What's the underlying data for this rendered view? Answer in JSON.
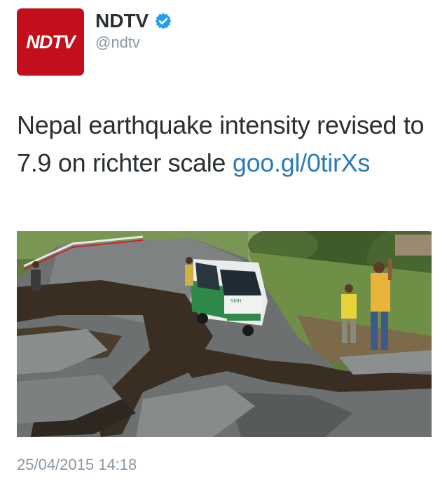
{
  "account": {
    "avatar_text": "NDTV",
    "display_name": "NDTV",
    "handle": "@ndtv",
    "verified": true,
    "brand_color": "#c30e1b"
  },
  "tweet": {
    "text": "Nepal earthquake intensity revised to 7.9 on richter scale ",
    "link": "goo.gl/0tirXs",
    "timestamp": "25/04/2015 14:18"
  },
  "photo": {
    "vehicle_label": "SMH"
  },
  "colors": {
    "link": "#2b7bb9",
    "secondary_text": "#8899a6",
    "verified_badge": "#1da1f2"
  }
}
